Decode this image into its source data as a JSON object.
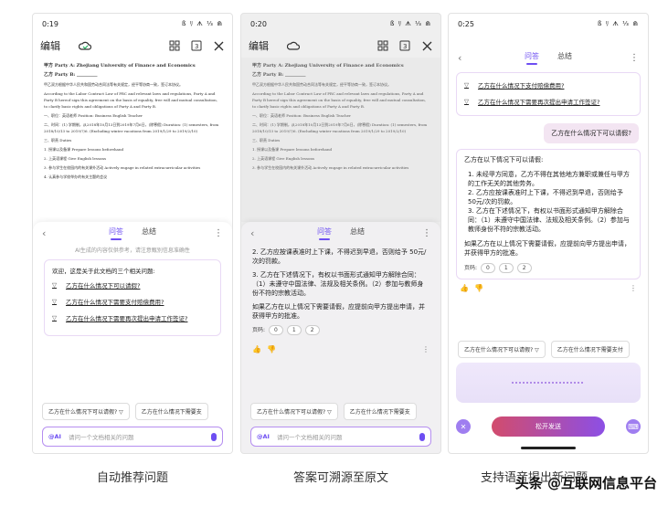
{
  "phones": [
    {
      "status": {
        "time": "0:19",
        "icons": "ß ﾘ ᗑ ⅓ ⋒"
      },
      "toolbar": {
        "edit": "编辑"
      },
      "doc": {
        "title": "甲方 Party A: Zhejiang University of Finance and Economics",
        "partyb": "乙方 Party B: _________",
        "p1": "甲乙双方根据中华人民共和国劳动合同法等有关规定，经平等协商一致，签订本协议。",
        "p2": "According to the Labor Contract Law of PRC and relevant laws and regulations, Party A and Party B hereof sign this agreement on the basis of equality, free will and mutual consultation, to clarify basic rights and obligations of Party A and Party B.",
        "p3": "一、职位：英语老师 Position: Business English Teacher",
        "p4": "二、时间：(1) 学期制，从2018年10月13日到2019年7月6日，(除寒假) Duration: (1) semesters, from 2018/10/13 to 2019/7/6. (Excluding winter vacations from 2019/1/29 to 2019/2/10)",
        "p5": "三、职责 Duties",
        "p6": "1. 授课以及备课 Prepare lessons beforehand",
        "p7": "2. 上英语课程 Give English lessons",
        "p8": "3. 参与学生在校园内的有关课外活动 Actively engage in related extracurricular activities",
        "p9": "4. 认真参与学校举办的有关主题的会议"
      },
      "tabs": {
        "qa": "问答",
        "summary": "总结"
      },
      "hint": "AI生成的内容仅供参考，请注意甄别信息准确性",
      "intro": "欢迎，这是关于此文档的三个相关问题:",
      "questions": [
        "乙方在什么情况下可以请假?",
        "乙方在什么情况下需要支付赔偿费用?",
        "乙方在什么情况下需要再次提出申请工作签证?"
      ],
      "chips": [
        "乙方在什么情况下可以请假?",
        "乙方在什么情况下需要支"
      ],
      "input": {
        "at": "@AI",
        "placeholder": "请问一个文档相关的问题"
      },
      "caption": "自动推荐问题"
    },
    {
      "status": {
        "time": "0:20",
        "icons": "ß ﾘ ᗑ ⅓ ⋒"
      },
      "toolbar": {
        "edit": "编辑"
      },
      "tabs": {
        "qa": "问答",
        "summary": "总结"
      },
      "answer": {
        "item2": "2. 乙方应按课表准时上下课，不得迟到早退，否则给予 50元/次的罚款。",
        "item3": "3. 乙方在下述情况下，有权以书面形式通知甲方解除合同：（1）未遵守中国法律、法规及相关条例。（2）参加与教师身份不符的宗教活动。",
        "extra": "如果乙方在以上情况下需要请假，应提前向甲方提出申请，并获得甲方的批准。",
        "pages_label": "页码:",
        "pages": [
          "0",
          "1",
          "2"
        ]
      },
      "chips": [
        "乙方在什么情况下可以请假?",
        "乙方在什么情况下需要支"
      ],
      "input": {
        "at": "@AI",
        "placeholder": "请问一个文档相关的问题"
      },
      "caption": "答案可溯源至原文"
    },
    {
      "status": {
        "time": "0:25",
        "icons": "ß ﾘ ᗑ ⅓ ⋒"
      },
      "tabs": {
        "qa": "问答",
        "summary": "总结"
      },
      "questions": [
        "乙方在什么情况下支付赔偿费用?",
        "乙方在什么情况下需要再次提出申请工作签证?"
      ],
      "user_question": "乙方在什么情况下可以请假?",
      "answer": {
        "lead": "乙方在以下情况下可以请假:",
        "item1": "1. 未经甲方同意，乙方不得在其他地方兼职或兼任与甲方的工作无关的其他劳务。",
        "item2": "2. 乙方应按课表准时上下课，不得迟到早退，否则给予 50元/次的罚款。",
        "item3": "3. 乙方在下述情况下，有权以书面形式通知甲方解除合同：（1）未遵守中国法律、法规及相关条例。（2）参加与教师身份不符的宗教活动。",
        "extra": "如果乙方在以上情况下需要请假，应提前向甲方提出申请，并获得甲方的批准。",
        "pages_label": "页码:",
        "pages": [
          "0",
          "1",
          "2"
        ]
      },
      "chips": [
        "乙方在什么情况下可以请假?",
        "乙方在什么情况下需要支付"
      ],
      "voice": {
        "release": "松开发送"
      },
      "caption": "支持语音提出新问题"
    }
  ],
  "watermark": "头条 @互联网信息平台"
}
